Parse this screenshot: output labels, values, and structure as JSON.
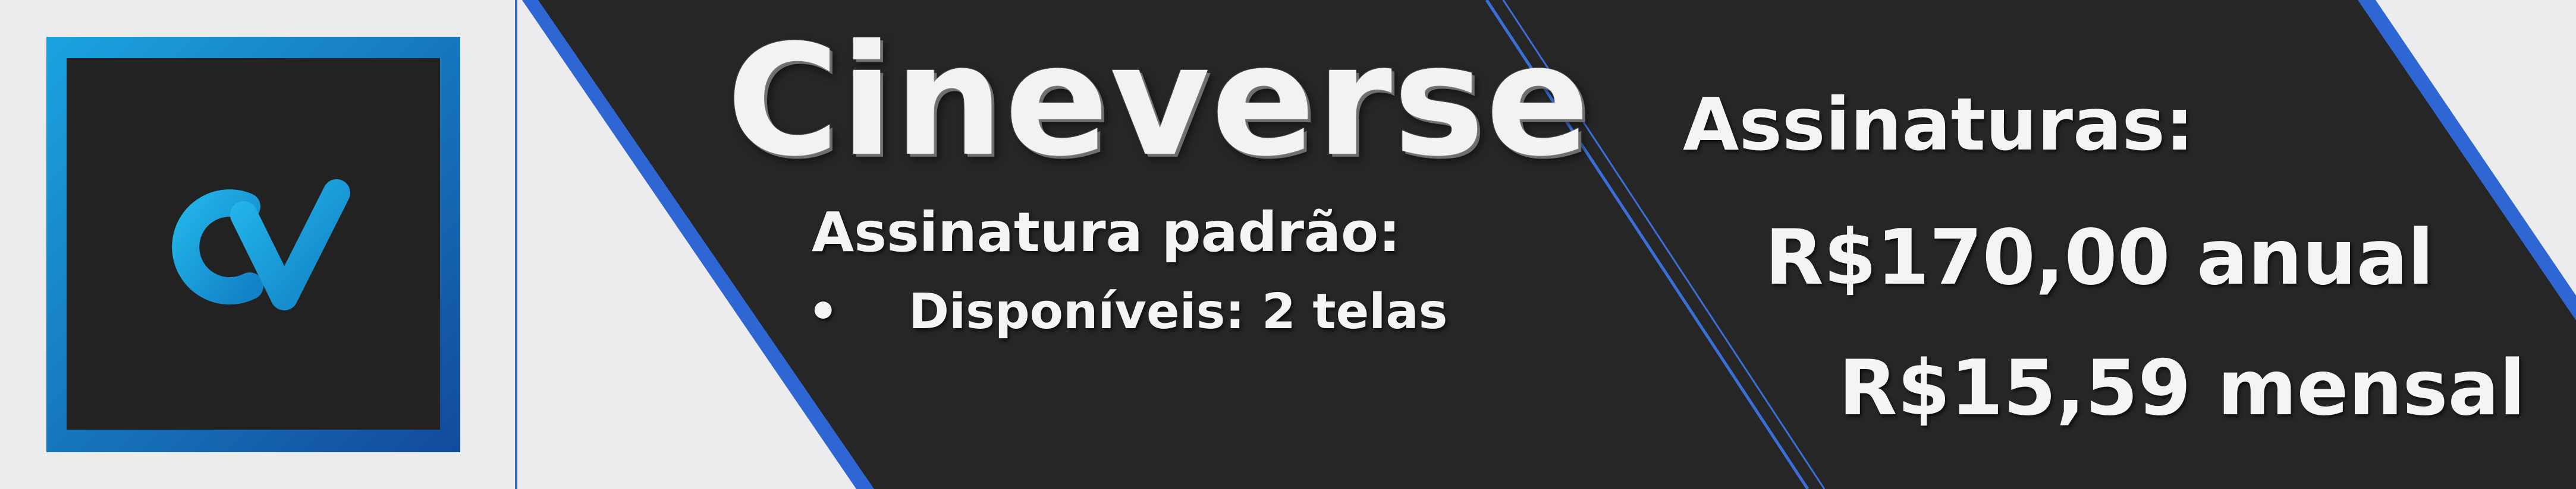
{
  "brand": {
    "name": "Cineverse",
    "logo_icon": "cineverse-cv-logo-icon",
    "colors": {
      "logo_border": "#1a86d4",
      "logo_bg": "#222222",
      "logo_mark": "#1ea5dd",
      "panel_bg": "#262626",
      "stripe_blue": "#2f6ed8",
      "page_bg": "#ececef"
    }
  },
  "standard_plan": {
    "title": "Assinatura padrão:",
    "bullet_symbol": "•",
    "features": [
      "Disponíveis: 2 telas"
    ]
  },
  "subscriptions": {
    "title": "Assinaturas:",
    "annual": "R$170,00 anual",
    "monthly": "R$15,59 mensal"
  }
}
